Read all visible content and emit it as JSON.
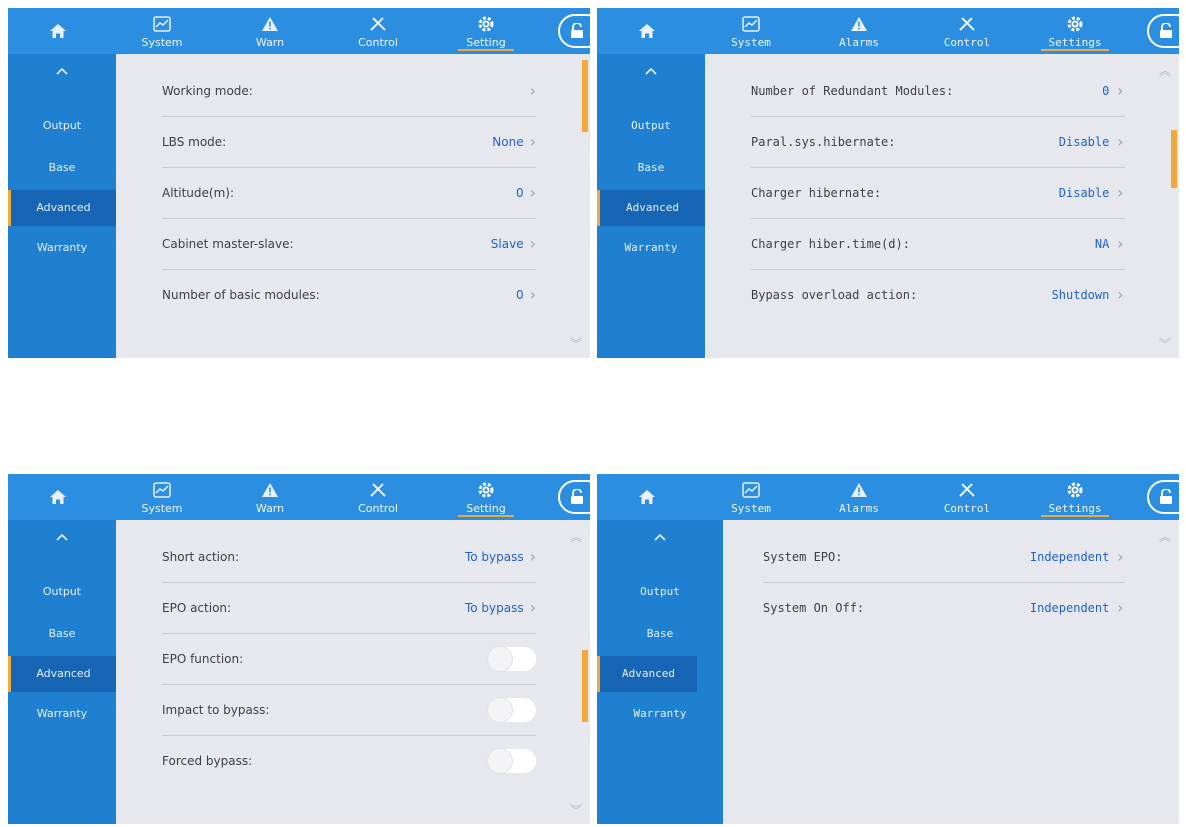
{
  "colors": {
    "topbar": "#2b8ee0",
    "sidebar": "#1f7fd1",
    "sidebar_active": "#1666b5",
    "accent": "#f2a93b",
    "value": "#1f63c4",
    "panel": "#e7e8ee"
  },
  "screens": [
    {
      "nav": {
        "system": "System",
        "warn": "Warn",
        "control": "Control",
        "setting": "Setting"
      },
      "sidebar": {
        "output": "Output",
        "base": "Base",
        "advanced": "Advanced",
        "warranty": "Warranty"
      },
      "rows": [
        {
          "label": "Working mode:",
          "value": ""
        },
        {
          "label": "LBS mode:",
          "value": "None"
        },
        {
          "label": "Altitude(m):",
          "value": "0"
        },
        {
          "label": "Cabinet master-slave:",
          "value": "Slave"
        },
        {
          "label": "Number of basic modules:",
          "value": "0"
        }
      ]
    },
    {
      "nav": {
        "system": "System",
        "warn": "Alarms",
        "control": "Control",
        "setting": "Settings"
      },
      "sidebar": {
        "output": "Output",
        "base": "Base",
        "advanced": "Advanced",
        "warranty": "Warranty"
      },
      "rows": [
        {
          "label": "Number of Redundant Modules:",
          "value": "0"
        },
        {
          "label": "Paral.sys.hibernate:",
          "value": "Disable"
        },
        {
          "label": "Charger hibernate:",
          "value": "Disable"
        },
        {
          "label": "Charger hiber.time(d):",
          "value": "NA"
        },
        {
          "label": "Bypass overload action:",
          "value": "Shutdown"
        }
      ]
    },
    {
      "nav": {
        "system": "System",
        "warn": "Warn",
        "control": "Control",
        "setting": "Setting"
      },
      "sidebar": {
        "output": "Output",
        "base": "Base",
        "advanced": "Advanced",
        "warranty": "Warranty"
      },
      "rows": [
        {
          "label": "Short action:",
          "value": "To bypass"
        },
        {
          "label": "EPO action:",
          "value": "To bypass"
        },
        {
          "label": "EPO function:",
          "toggle": "off"
        },
        {
          "label": "Impact to bypass:",
          "toggle": "off"
        },
        {
          "label": "Forced bypass:",
          "toggle": "off"
        }
      ]
    },
    {
      "nav": {
        "system": "System",
        "warn": "Alarms",
        "control": "Control",
        "setting": "Settings"
      },
      "sidebar": {
        "output": "Output",
        "base": "Base",
        "advanced": "Advanced",
        "warranty": "Warranty"
      },
      "rows": [
        {
          "label": "System EPO:",
          "value": "Independent"
        },
        {
          "label": "System On Off:",
          "value": "Independent"
        }
      ]
    }
  ]
}
